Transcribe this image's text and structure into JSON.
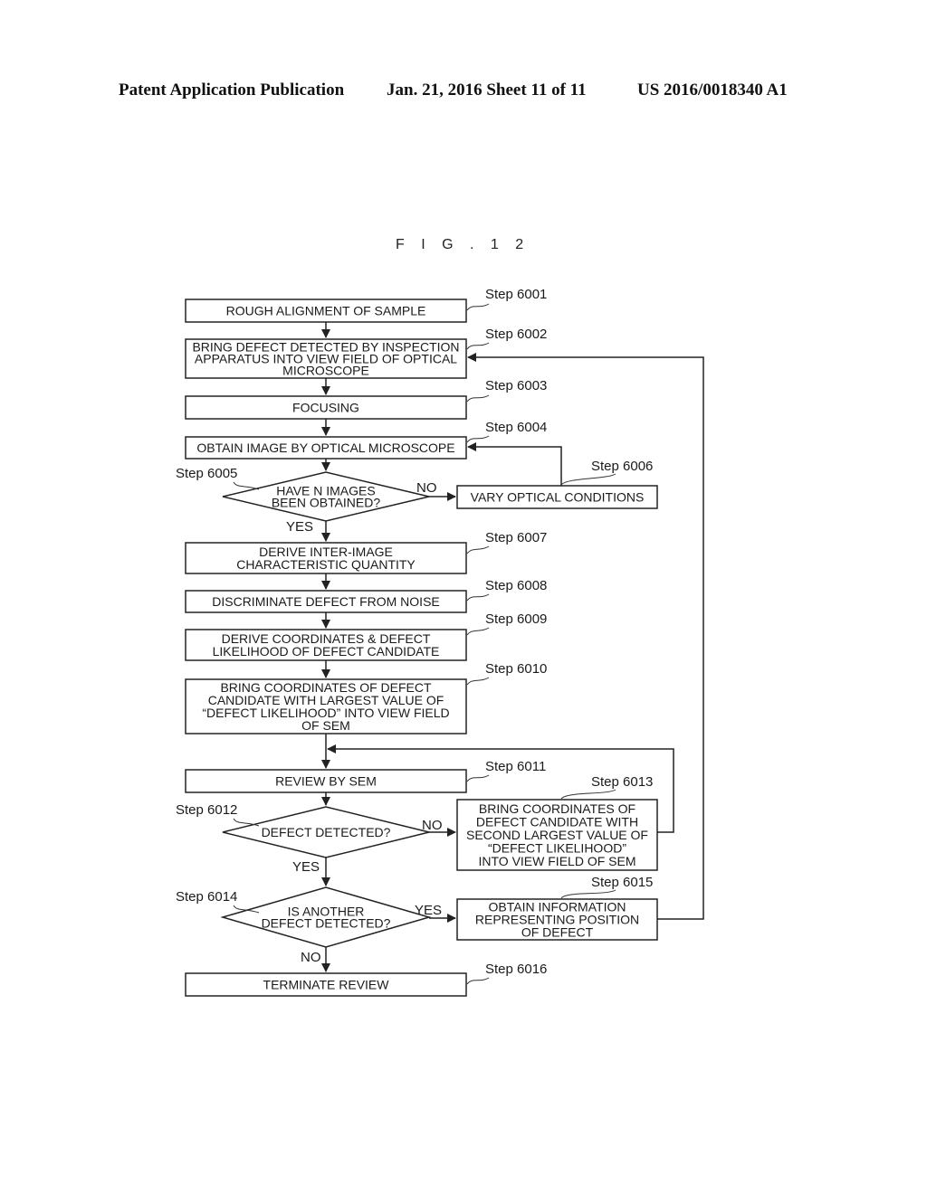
{
  "header": {
    "publication": "Patent Application Publication",
    "date_sheet": "Jan. 21, 2016  Sheet 11 of 11",
    "number": "US 2016/0018340 A1"
  },
  "figure": {
    "title": "F I G .  1 2",
    "steps": {
      "s6001": {
        "label": "Step 6001",
        "lines": [
          "ROUGH ALIGNMENT OF SAMPLE"
        ]
      },
      "s6002": {
        "label": "Step 6002",
        "lines": [
          "BRING DEFECT DETECTED BY INSPECTION",
          "APPARATUS INTO VIEW FIELD OF OPTICAL",
          "MICROSCOPE"
        ]
      },
      "s6003": {
        "label": "Step 6003",
        "lines": [
          "FOCUSING"
        ]
      },
      "s6004": {
        "label": "Step 6004",
        "lines": [
          "OBTAIN IMAGE BY OPTICAL MICROSCOPE"
        ]
      },
      "s6005": {
        "label": "Step 6005",
        "lines": [
          "HAVE N IMAGES",
          "BEEN OBTAINED?"
        ]
      },
      "s6006": {
        "label": "Step 6006",
        "lines": [
          "VARY OPTICAL CONDITIONS"
        ]
      },
      "s6007": {
        "label": "Step 6007",
        "lines": [
          "DERIVE INTER-IMAGE",
          "CHARACTERISTIC QUANTITY"
        ]
      },
      "s6008": {
        "label": "Step 6008",
        "lines": [
          "DISCRIMINATE DEFECT FROM NOISE"
        ]
      },
      "s6009": {
        "label": "Step 6009",
        "lines": [
          "DERIVE COORDINATES & DEFECT",
          "LIKELIHOOD OF DEFECT CANDIDATE"
        ]
      },
      "s6010": {
        "label": "Step 6010",
        "lines": [
          "BRING COORDINATES OF DEFECT",
          "CANDIDATE WITH LARGEST VALUE OF",
          "“DEFECT LIKELIHOOD” INTO VIEW FIELD",
          "OF SEM"
        ]
      },
      "s6011": {
        "label": "Step 6011",
        "lines": [
          "REVIEW BY SEM"
        ]
      },
      "s6012": {
        "label": "Step 6012",
        "lines": [
          "DEFECT DETECTED?"
        ]
      },
      "s6013": {
        "label": "Step 6013",
        "lines": [
          "BRING COORDINATES OF",
          "DEFECT CANDIDATE WITH",
          "SECOND LARGEST VALUE OF",
          "“DEFECT LIKELIHOOD”",
          "INTO VIEW FIELD OF SEM"
        ]
      },
      "s6014": {
        "label": "Step 6014",
        "lines": [
          "IS ANOTHER",
          "DEFECT DETECTED?"
        ]
      },
      "s6015": {
        "label": "Step 6015",
        "lines": [
          "OBTAIN INFORMATION",
          "REPRESENTING POSITION",
          "OF DEFECT"
        ]
      },
      "s6016": {
        "label": "Step 6016",
        "lines": [
          "TERMINATE REVIEW"
        ]
      }
    },
    "branch_labels": {
      "d6005_no": "NO",
      "d6005_yes": "YES",
      "d6012_no": "NO",
      "d6012_yes": "YES",
      "d6014_yes": "YES",
      "d6014_no": "NO"
    }
  }
}
